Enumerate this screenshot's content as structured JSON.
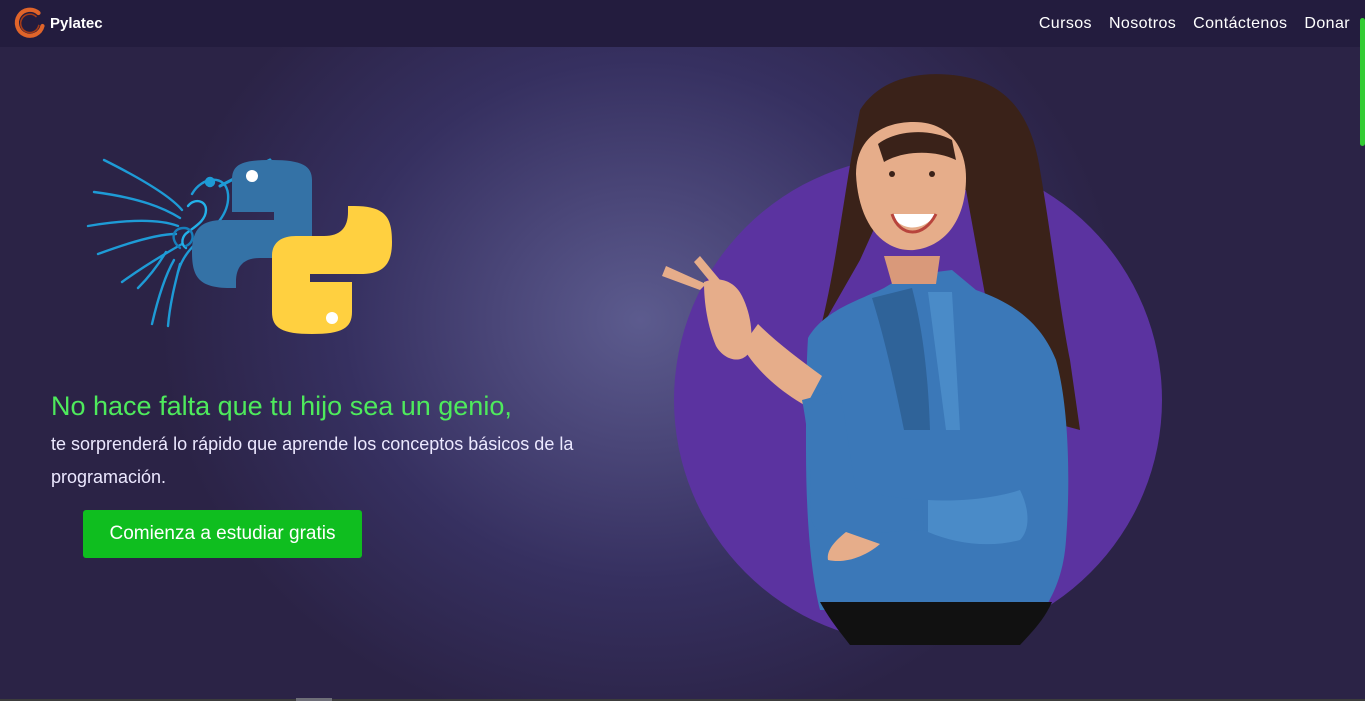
{
  "nav": {
    "brand": "Pylatec",
    "links": [
      {
        "label": "Cursos"
      },
      {
        "label": "Nosotros"
      },
      {
        "label": "Contáctenos"
      },
      {
        "label": "Donar"
      }
    ]
  },
  "hero": {
    "headline": "No hace falta que tu hijo sea un genio,",
    "subtext": "te sorprenderá lo rápido que aprende los conceptos básicos de la programación.",
    "cta_label": "Comienza a estudiar gratis"
  },
  "colors": {
    "background": "#2b2347",
    "navbar": "#231c3e",
    "headline": "#4eea5c",
    "cta": "#0fbe1f",
    "circle": "#5b33a0",
    "brand_logo": "#e0642a",
    "python_blue": "#3472a6",
    "python_yellow": "#ffd040",
    "hummingbird": "#1e9bd6"
  },
  "icons": [
    "brand-logo-icon",
    "hummingbird-icon",
    "python-logo-icon"
  ]
}
